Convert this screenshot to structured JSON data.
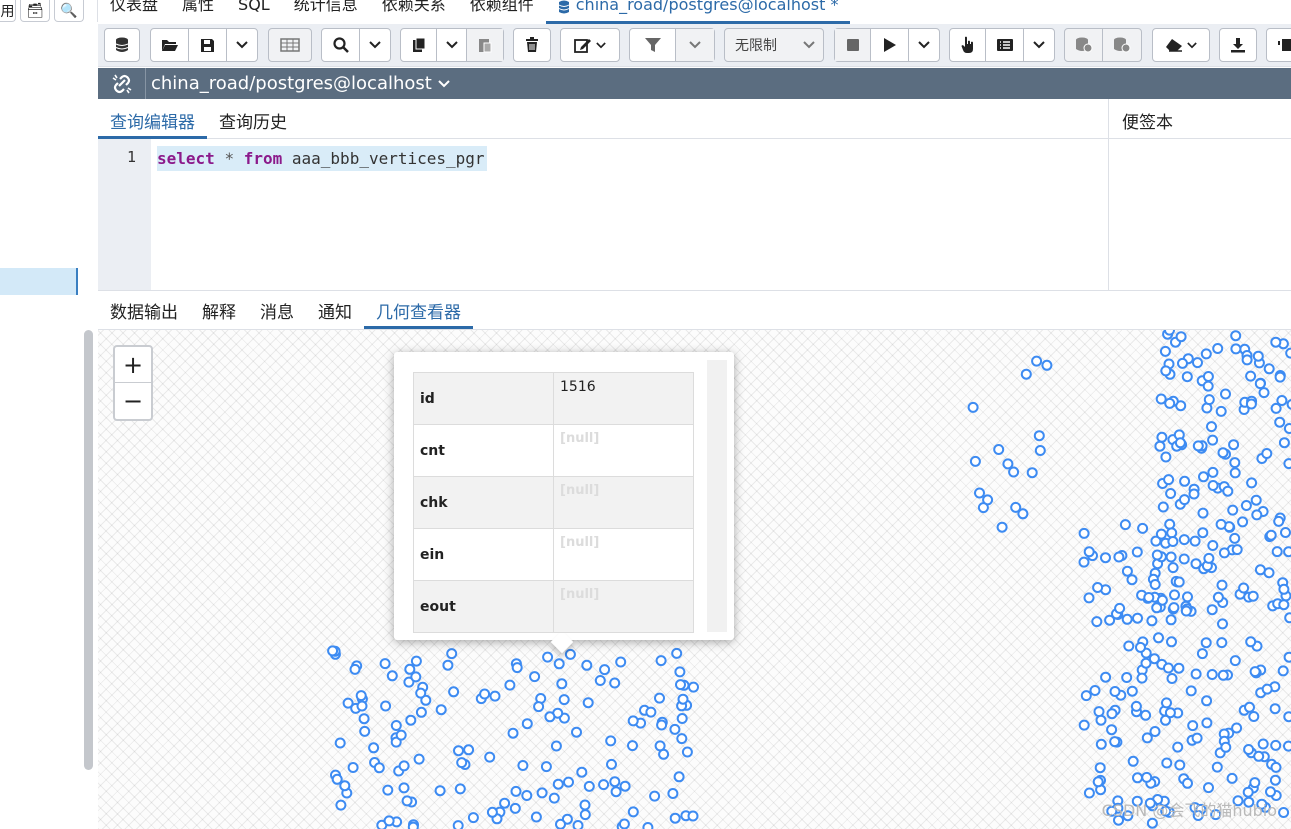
{
  "left_panel": {
    "tools": [
      {
        "label": "用",
        "icon": "table-icon"
      },
      {
        "label": "🗃",
        "icon": "table-tree-icon"
      },
      {
        "label": "🔍",
        "icon": "search-icon"
      }
    ]
  },
  "top_tabs": [
    {
      "label": "仪表盘"
    },
    {
      "label": "属性"
    },
    {
      "label": "SQL"
    },
    {
      "label": "统计信息"
    },
    {
      "label": "依赖关系"
    },
    {
      "label": "依赖组件"
    },
    {
      "label": "china_road/postgres@localhost *",
      "active": true
    }
  ],
  "toolbar": {
    "limit_label": "无限制"
  },
  "connection": {
    "label": "china_road/postgres@localhost"
  },
  "editor_tabs": [
    {
      "label": "查询编辑器",
      "active": true
    },
    {
      "label": "查询历史"
    }
  ],
  "scratch_pad": {
    "label": "便签本"
  },
  "editor": {
    "line_number": "1",
    "tokens": {
      "kw1": "select",
      "star": "*",
      "kw2": "from",
      "table": "aaa_bbb_vertices_pgr"
    }
  },
  "output_tabs": [
    {
      "label": "数据输出"
    },
    {
      "label": "解释"
    },
    {
      "label": "消息"
    },
    {
      "label": "通知"
    },
    {
      "label": "几何查看器",
      "active": true
    }
  ],
  "map": {
    "zoom_in": "+",
    "zoom_out": "−",
    "point_color": "#3d8bf2"
  },
  "popup": {
    "rows": [
      {
        "key": "id",
        "value": "1516"
      },
      {
        "key": "cnt",
        "value": "[null]"
      },
      {
        "key": "chk",
        "value": "[null]"
      },
      {
        "key": "ein",
        "value": "[null]"
      },
      {
        "key": "eout",
        "value": "[null]"
      }
    ]
  },
  "watermark": "CSDN @会飞的猫hubio"
}
